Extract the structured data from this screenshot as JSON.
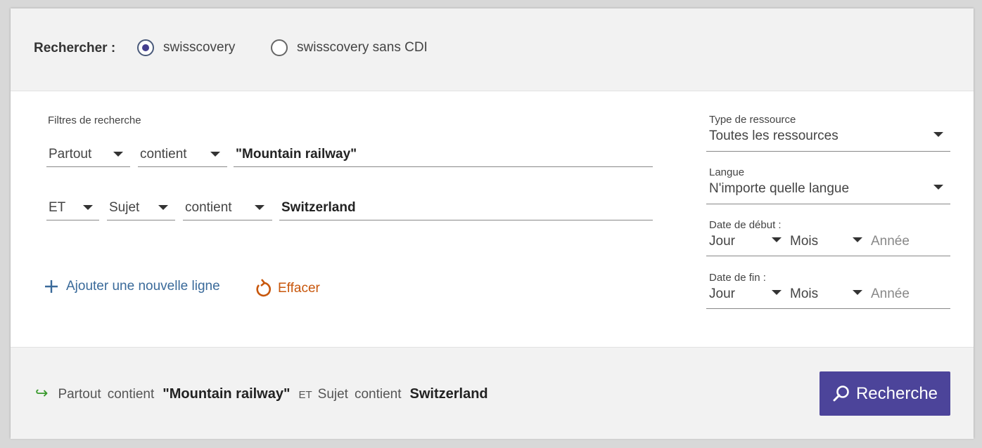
{
  "scope": {
    "label": "Rechercher :",
    "options": [
      {
        "label": "swisscovery",
        "selected": true
      },
      {
        "label": "swisscovery sans CDI",
        "selected": false
      }
    ]
  },
  "filters": {
    "title": "Filtres de recherche",
    "rows": [
      {
        "operator": "",
        "field": "Partout",
        "condition": "contient",
        "value": "\"Mountain railway\""
      },
      {
        "operator": "ET",
        "field": "Sujet",
        "condition": "contient",
        "value": "Switzerland"
      }
    ],
    "add_line_label": "Ajouter une nouvelle ligne",
    "clear_label": "Effacer"
  },
  "side": {
    "resource_type": {
      "label": "Type de ressource",
      "value": "Toutes les ressources"
    },
    "language": {
      "label": "Langue",
      "value": "N'importe quelle langue"
    },
    "start_date": {
      "label": "Date de début :",
      "day": "Jour",
      "month": "Mois",
      "year_placeholder": "Année"
    },
    "end_date": {
      "label": "Date de fin :",
      "day": "Jour",
      "month": "Mois",
      "year_placeholder": "Année"
    }
  },
  "summary": {
    "row1_field": "Partout",
    "row1_condition": "contient",
    "row1_value": "\"Mountain railway\"",
    "row2_operator": "ET",
    "row2_field": "Sujet",
    "row2_condition": "contient",
    "row2_value": "Switzerland"
  },
  "search_button_label": "Recherche",
  "colors": {
    "accent": "#4c449a",
    "link_blue": "#3a6a9a",
    "clear_orange": "#c8570c",
    "summary_arrow": "#3a9a2e"
  }
}
